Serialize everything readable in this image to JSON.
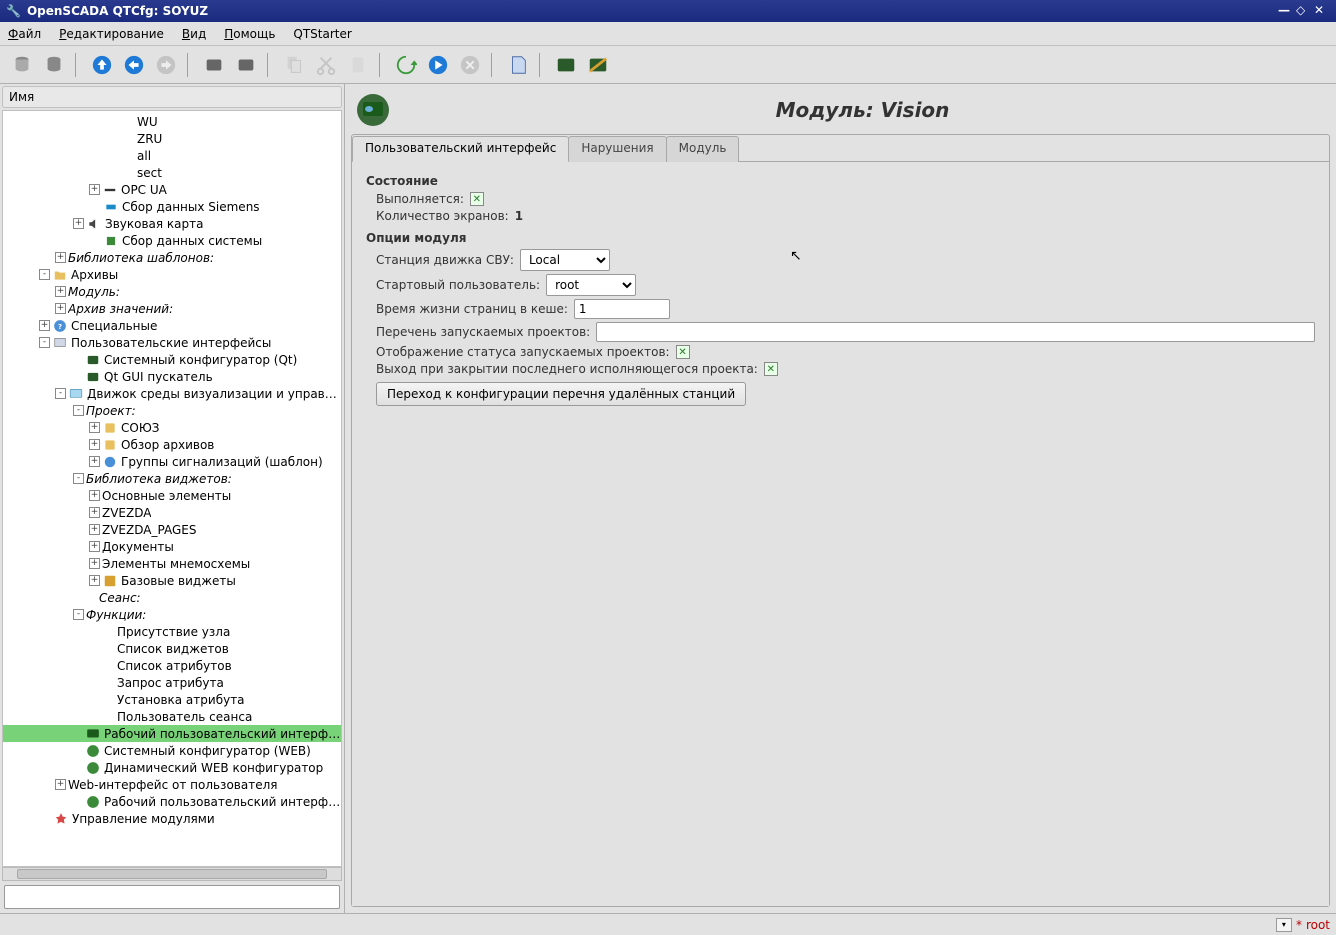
{
  "window": {
    "title": "OpenSCADA QTCfg: SOYUZ"
  },
  "menu": {
    "file": "Файл",
    "edit": "Редактирование",
    "view": "Вид",
    "help": "Помощь",
    "qtstarter": "QTStarter"
  },
  "sidebar": {
    "header": "Имя"
  },
  "tree": {
    "items": [
      {
        "pad": 120,
        "exp": "",
        "label": "WU"
      },
      {
        "pad": 120,
        "exp": "",
        "label": "ZRU"
      },
      {
        "pad": 120,
        "exp": "",
        "label": "all"
      },
      {
        "pad": 120,
        "exp": "",
        "label": "sect"
      },
      {
        "pad": 86,
        "exp": "+",
        "icon": "opcua",
        "label": "OPC UA"
      },
      {
        "pad": 86,
        "exp": "",
        "icon": "siemens",
        "label": "Сбор данных Siemens"
      },
      {
        "pad": 70,
        "exp": "+",
        "icon": "sound",
        "label": "Звуковая карта"
      },
      {
        "pad": 86,
        "exp": "",
        "icon": "system",
        "label": "Сбор данных системы"
      },
      {
        "pad": 52,
        "exp": "+",
        "italic": true,
        "label": "Библиотека шаблонов:"
      },
      {
        "pad": 36,
        "exp": "-",
        "icon": "folder",
        "label": "Архивы"
      },
      {
        "pad": 52,
        "exp": "+",
        "italic": true,
        "label": "Модуль:"
      },
      {
        "pad": 52,
        "exp": "+",
        "italic": true,
        "label": "Архив значений:"
      },
      {
        "pad": 36,
        "exp": "+",
        "icon": "info",
        "label": "Специальные"
      },
      {
        "pad": 36,
        "exp": "-",
        "icon": "ui",
        "label": "Пользовательские интерфейсы"
      },
      {
        "pad": 68,
        "exp": "",
        "icon": "qtcfg",
        "label": "Системный конфигуратор (Qt)"
      },
      {
        "pad": 68,
        "exp": "",
        "icon": "qtcfg",
        "label": "Qt GUI пускатель"
      },
      {
        "pad": 52,
        "exp": "-",
        "icon": "vision",
        "label": "Движок среды визуализации и управления"
      },
      {
        "pad": 70,
        "exp": "-",
        "italic": true,
        "label": "Проект:"
      },
      {
        "pad": 86,
        "exp": "+",
        "icon": "proj",
        "label": "СОЮЗ"
      },
      {
        "pad": 86,
        "exp": "+",
        "icon": "proj",
        "label": "Обзор архивов"
      },
      {
        "pad": 86,
        "exp": "+",
        "icon": "grp",
        "label": "Группы сигнализаций (шаблон)"
      },
      {
        "pad": 70,
        "exp": "-",
        "italic": true,
        "label": "Библиотека виджетов:"
      },
      {
        "pad": 86,
        "exp": "+",
        "label": "Основные элементы"
      },
      {
        "pad": 86,
        "exp": "+",
        "label": "ZVEZDA"
      },
      {
        "pad": 86,
        "exp": "+",
        "label": "ZVEZDA_PAGES"
      },
      {
        "pad": 86,
        "exp": "+",
        "label": "Документы"
      },
      {
        "pad": 86,
        "exp": "+",
        "label": "Элементы мнемосхемы"
      },
      {
        "pad": 86,
        "exp": "+",
        "icon": "basewg",
        "label": "Базовые виджеты"
      },
      {
        "pad": 82,
        "exp": "",
        "italic": true,
        "label": "Сеанс:"
      },
      {
        "pad": 70,
        "exp": "-",
        "italic": true,
        "label": "Функции:"
      },
      {
        "pad": 100,
        "exp": "",
        "label": "Присутствие узла"
      },
      {
        "pad": 100,
        "exp": "",
        "label": "Список виджетов"
      },
      {
        "pad": 100,
        "exp": "",
        "label": "Список атрибутов"
      },
      {
        "pad": 100,
        "exp": "",
        "label": "Запрос атрибута"
      },
      {
        "pad": 100,
        "exp": "",
        "label": "Установка атрибута"
      },
      {
        "pad": 100,
        "exp": "",
        "label": "Пользователь сеанса"
      },
      {
        "pad": 68,
        "exp": "",
        "icon": "vision-sel",
        "label": "Рабочий пользовательский интерфейс",
        "selected": true
      },
      {
        "pad": 68,
        "exp": "",
        "icon": "web",
        "label": "Системный конфигуратор (WEB)"
      },
      {
        "pad": 68,
        "exp": "",
        "icon": "webd",
        "label": "Динамический WEB конфигуратор"
      },
      {
        "pad": 52,
        "exp": "+",
        "label": "Web-интерфейс от пользователя"
      },
      {
        "pad": 68,
        "exp": "",
        "icon": "webui",
        "label": "Рабочий пользовательский интерфейс"
      },
      {
        "pad": 36,
        "exp": "",
        "icon": "mgmt",
        "label": "Управление модулями"
      }
    ]
  },
  "module": {
    "title": "Модуль: Vision",
    "tabs": {
      "t1": "Пользовательский интерфейс",
      "t2": "Нарушения",
      "t3": "Модуль"
    },
    "section_state": "Состояние",
    "running_lbl": "Выполняется:",
    "screens_lbl": "Количество экранов:",
    "screens_val": "1",
    "section_opts": "Опции модуля",
    "station_lbl": "Станция движка СВУ:",
    "station_val": "Local",
    "startuser_lbl": "Стартовый пользователь:",
    "startuser_val": "root",
    "cache_lbl": "Время жизни страниц в кеше:",
    "cache_val": "1",
    "projects_lbl": "Перечень запускаемых проектов:",
    "projects_val": "",
    "status_lbl": "Отображение статуса запускаемых проектов:",
    "exit_lbl": "Выход при закрытии последнего исполняющегося проекта:",
    "button": "Переход к конфигурации перечня удалённых станций"
  },
  "status": {
    "user": "root",
    "star": "*"
  }
}
